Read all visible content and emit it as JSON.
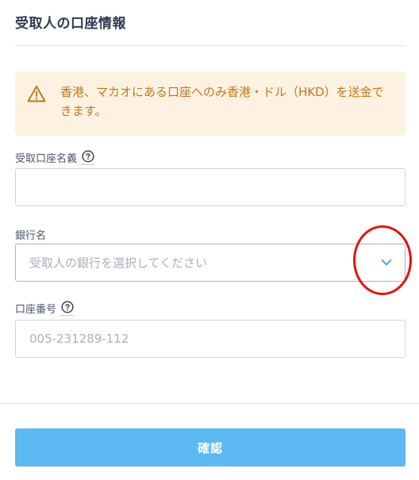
{
  "section": {
    "title": "受取人の口座情報"
  },
  "warning": {
    "icon": "warning-triangle-icon",
    "text": "香港、マカオにある口座へのみ香港・ドル（HKD）を送金できます。"
  },
  "fields": {
    "account_name": {
      "label": "受取口座名義",
      "value": "",
      "help_icon": "question-circle-icon"
    },
    "bank_name": {
      "label": "銀行名",
      "placeholder": "受取人の銀行を選択してください",
      "icon": "chevron-down-icon"
    },
    "account_number": {
      "label": "口座番号",
      "placeholder": "005-231289-112",
      "help_icon": "question-circle-icon"
    }
  },
  "confirm_button": {
    "label": "確認"
  },
  "colors": {
    "accent": "#5cb9f1",
    "warning_bg": "#fdf2e2",
    "warning_text": "#c4761a",
    "highlight": "#e41212"
  }
}
